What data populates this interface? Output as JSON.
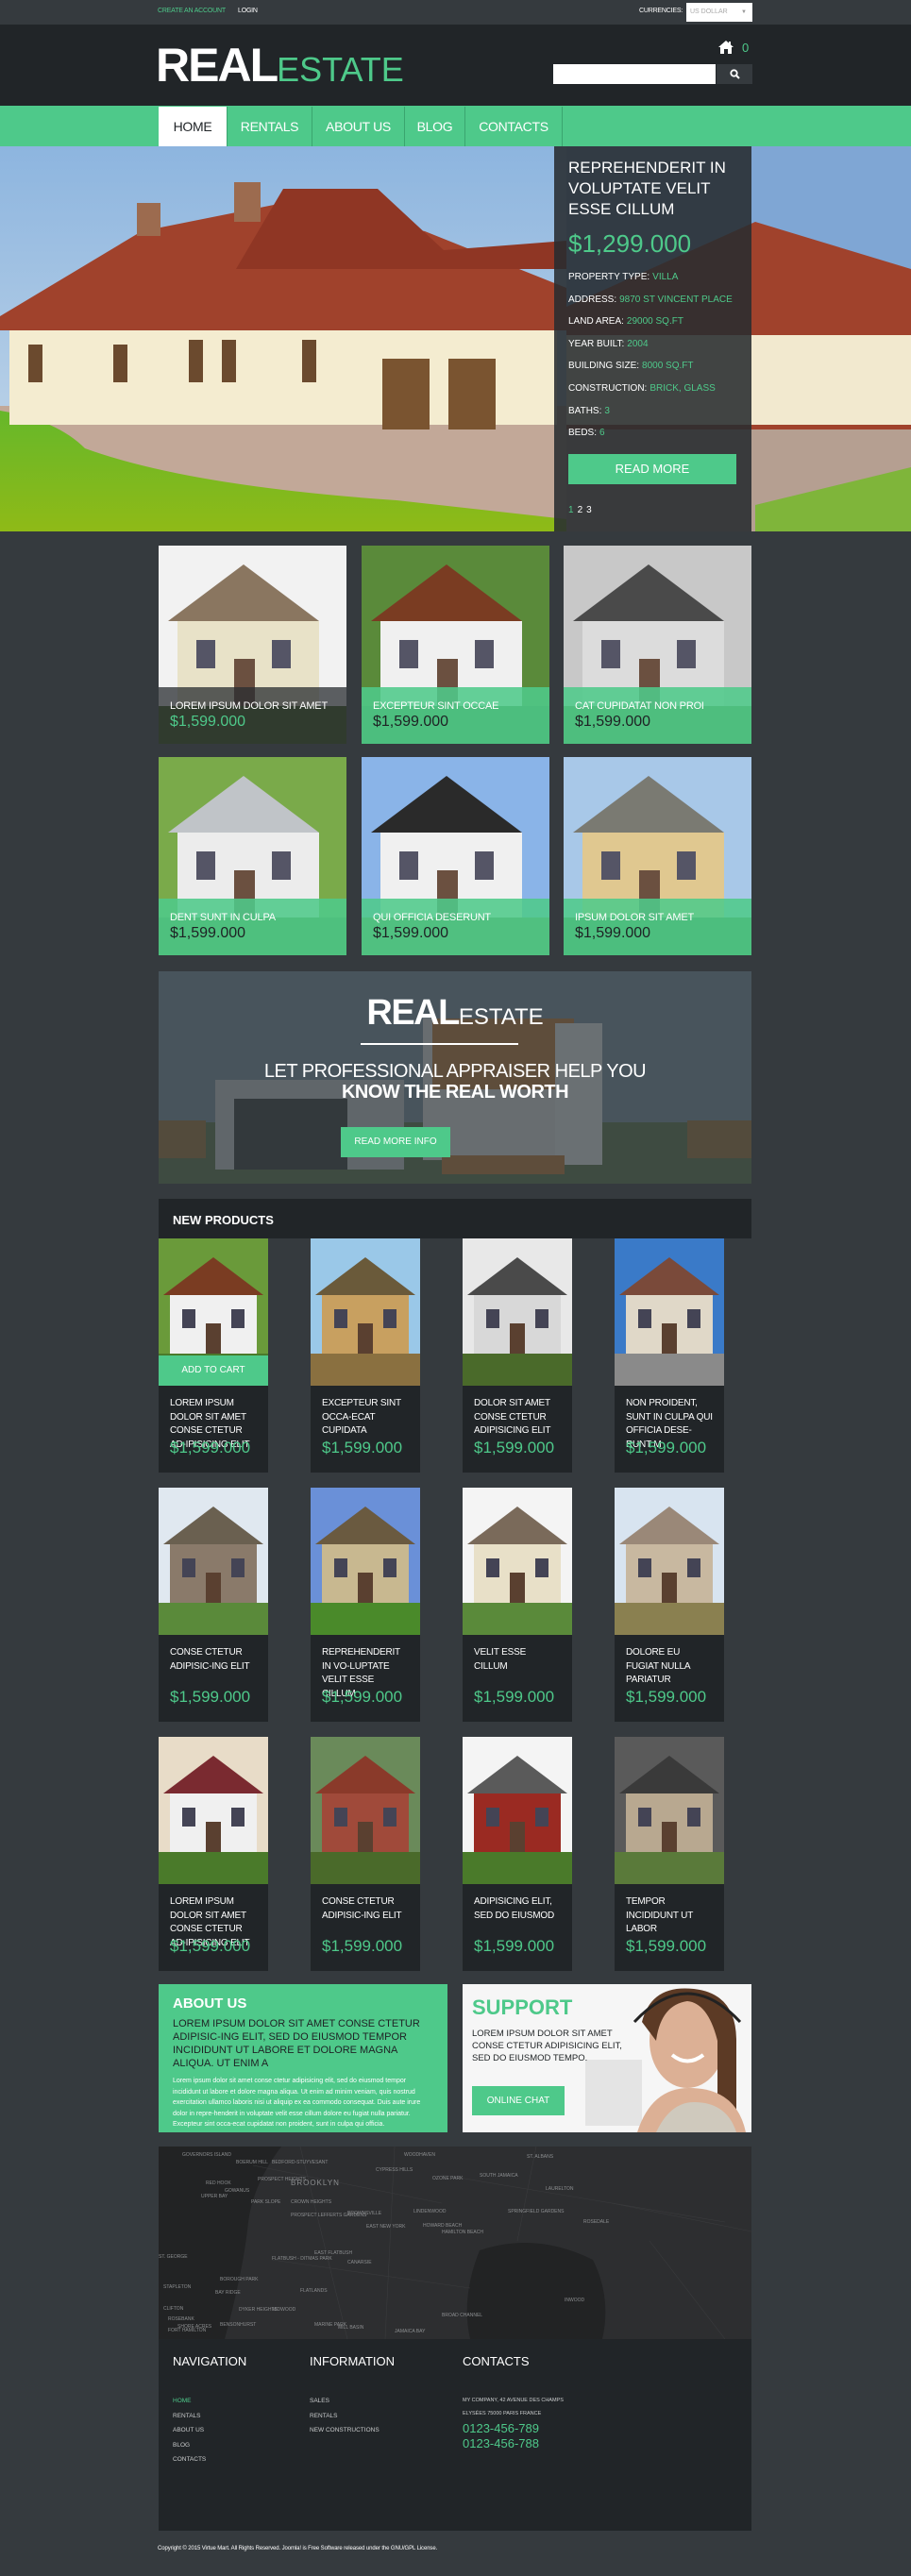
{
  "topbar": {
    "create_account": "CREATE AN ACCOUNT",
    "login": "LOGIN",
    "currency_label": "CURRENCIES:",
    "currency_value": "US DOLLAR"
  },
  "header": {
    "logo_bold": "REAL",
    "logo_light": "ESTATE",
    "cart_icon": "house-icon",
    "cart_count": "0",
    "search_placeholder": "",
    "search_icon": "search-icon"
  },
  "nav": {
    "items": [
      {
        "label": "HOME",
        "active": true
      },
      {
        "label": "RENTALS",
        "active": false
      },
      {
        "label": "ABOUT US",
        "active": false
      },
      {
        "label": "BLOG",
        "active": false
      },
      {
        "label": "CONTACTS",
        "active": false
      }
    ]
  },
  "hero": {
    "title": "REPREHENDERIT IN VOLUPTATE VELIT ESSE CILLUM",
    "price": "$1,299.000",
    "specs": [
      {
        "label": "PROPERTY TYPE:",
        "value": "VILLA"
      },
      {
        "label": "ADDRESS:",
        "value": "9870 ST VINCENT PLACE"
      },
      {
        "label": "LAND AREA:",
        "value": "29000 SQ.FT"
      },
      {
        "label": "YEAR BUILT:",
        "value": "2004"
      },
      {
        "label": "BUILDING SIZE:",
        "value": "8000 SQ.FT"
      },
      {
        "label": "CONSTRUCTION:",
        "value": "BRICK, GLASS"
      },
      {
        "label": "BATHS:",
        "value": "3"
      },
      {
        "label": "BEDS:",
        "value": "6"
      }
    ],
    "read_more": "READ MORE",
    "pages": [
      "1",
      "2",
      "3"
    ],
    "current_page": "1"
  },
  "featured": [
    {
      "title": "LOREM IPSUM DOLOR SIT AMET",
      "price": "$1,599.000",
      "style": "dark"
    },
    {
      "title": "EXCEPTEUR SINT OCCAE",
      "price": "$1,599.000",
      "style": "green"
    },
    {
      "title": "CAT CUPIDATAT NON PROI",
      "price": "$1,599.000",
      "style": "green"
    },
    {
      "title": "DENT SUNT IN CULPA",
      "price": "$1,599.000",
      "style": "green"
    },
    {
      "title": "QUI OFFICIA DESERUNT",
      "price": "$1,599.000",
      "style": "green"
    },
    {
      "title": "IPSUM DOLOR SIT AMET",
      "price": "$1,599.000",
      "style": "green"
    }
  ],
  "banner": {
    "logo_bold": "REAL",
    "logo_light": "ESTATE",
    "line1": "LET PROFESSIONAL APPRAISER HELP YOU",
    "line2": "KNOW THE REAL WORTH",
    "button": "READ MORE INFO"
  },
  "new_products": {
    "title": "NEW PRODUCTS",
    "add_to_cart": "ADD TO CART",
    "items": [
      {
        "title": "LOREM IPSUM DOLOR SIT AMET CONSE CTETUR AD-IPISICING ELIT",
        "price": "$1,599.000"
      },
      {
        "title": "EXCEPTEUR SINT OCCA-ECAT CUPIDATA",
        "price": "$1,599.000"
      },
      {
        "title": "DOLOR SIT AMET CONSE CTETUR ADIPISICING ELIT",
        "price": "$1,599.000"
      },
      {
        "title": "NON PROIDENT, SUNT IN CULPA QUI OFFICIA DESE-RUNT M",
        "price": "$1,599.000"
      },
      {
        "title": "CONSE CTETUR ADIPISIC-ING ELIT",
        "price": "$1,599.000"
      },
      {
        "title": "REPREHENDERIT IN VO-LUPTATE VELIT ESSE CILLUM",
        "price": "$1,599.000"
      },
      {
        "title": "VELIT ESSE CILLUM",
        "price": "$1,599.000"
      },
      {
        "title": "DOLORE EU FUGIAT NULLA PARIATUR",
        "price": "$1,599.000"
      },
      {
        "title": "LOREM IPSUM DOLOR SIT AMET CONSE CTETUR AD-IPISICING ELIT",
        "price": "$1,599.000"
      },
      {
        "title": "CONSE CTETUR ADIPISIC-ING ELIT",
        "price": "$1,599.000"
      },
      {
        "title": "ADIPISICING ELIT, SED DO EIUSMOD",
        "price": "$1,599.000"
      },
      {
        "title": "TEMPOR INCIDIDUNT UT LABOR",
        "price": "$1,599.000"
      }
    ]
  },
  "about": {
    "title": "ABOUT US",
    "lead": "LOREM IPSUM DOLOR SIT AMET CONSE CTETUR ADIPISIC-ING ELIT, SED DO EIUSMOD TEMPOR INCIDIDUNT UT LABORE ET DOLORE MAGNA ALIQUA. UT ENIM A",
    "body": "Lorem ipsum dolor sit amet conse ctetur adipisicing elit, sed do eiusmod tempor incididunt ut labore et dolore magna aliqua. Ut enim ad minim veniam, quis nostrud exercitation ullamco laboris nisi ut aliquip ex ea commodo consequat. Duis aute irure dolor in repre-henderit in voluptate velit esse cillum dolore eu fugiat nulla pariatur. Excepteur sint occa-ecat cupidatat non proident, sunt in culpa qui officia."
  },
  "support": {
    "title": "SUPPORT",
    "text": "LOREM IPSUM DOLOR SIT AMET CONSE CTETUR ADIPISICING ELIT, SED DO EIUSMOD TEMPO.",
    "button": "ONLINE CHAT"
  },
  "map": {
    "labels": [
      "GOVERNORS ISLAND",
      "BOERUM HILL",
      "RED HOOK",
      "GOWANUS",
      "PROSPECT HEIGHTS",
      "BROOKLYN",
      "BEDFORD-STUYVESANT",
      "CYPRESS HILLS",
      "WOODHAVEN",
      "OZONE PARK",
      "SOUTH JAMAICA",
      "ST. ALBANS",
      "LAURELTON",
      "UPPER BAY",
      "PARK SLOPE",
      "CROWN HEIGHTS",
      "BROWNSVILLE",
      "LINDENWOOD",
      "SPRINGFIELD GARDENS",
      "ROSEDALE",
      "PROSPECT LEFFERTS GARDENS",
      "EAST NEW YORK",
      "HOWARD BEACH",
      "HAMILTON BEACH",
      "ST. GEORGE",
      "FLATBUSH - DITMAS PARK",
      "EAST FLATBUSH",
      "CANARSIE",
      "STAPLETON",
      "BOROUGH PARK",
      "BAY RIDGE",
      "FLATLANDS",
      "INWOOD",
      "CLIFTON",
      "DYKER HEIGHTS",
      "MIDWOOD",
      "BROAD CHANNEL",
      "ROSEBANK",
      "SHORE ACRES",
      "FORT HAMILTON",
      "BENSONHURST",
      "MARINE PARK",
      "MILL BASIN",
      "JAMAICA BAY"
    ]
  },
  "footer": {
    "navigation_title": "NAVIGATION",
    "navigation": [
      "HOME",
      "RENTALS",
      "ABOUT US",
      "BLOG",
      "CONTACTS"
    ],
    "information_title": "INFORMATION",
    "information": [
      "SALES",
      "RENTALS",
      "NEW CONSTRUCTIONS"
    ],
    "contacts_title": "CONTACTS",
    "address_line1": "MY COMPANY, 42 AVENUE DES  CHAMPS",
    "address_line2": "ELYSÉES  75000  PARIS FRANCE",
    "phone1": "0123-456-789",
    "phone2": "0123-456-788",
    "copyright": "Copyright © 2015 Virtue Mart.  All Rights Reserved. Joomla! is Free Software released under the GNU/GPL License."
  },
  "colors": {
    "accent": "#4ec98a",
    "dark": "#212528",
    "background": "#353a3e"
  }
}
